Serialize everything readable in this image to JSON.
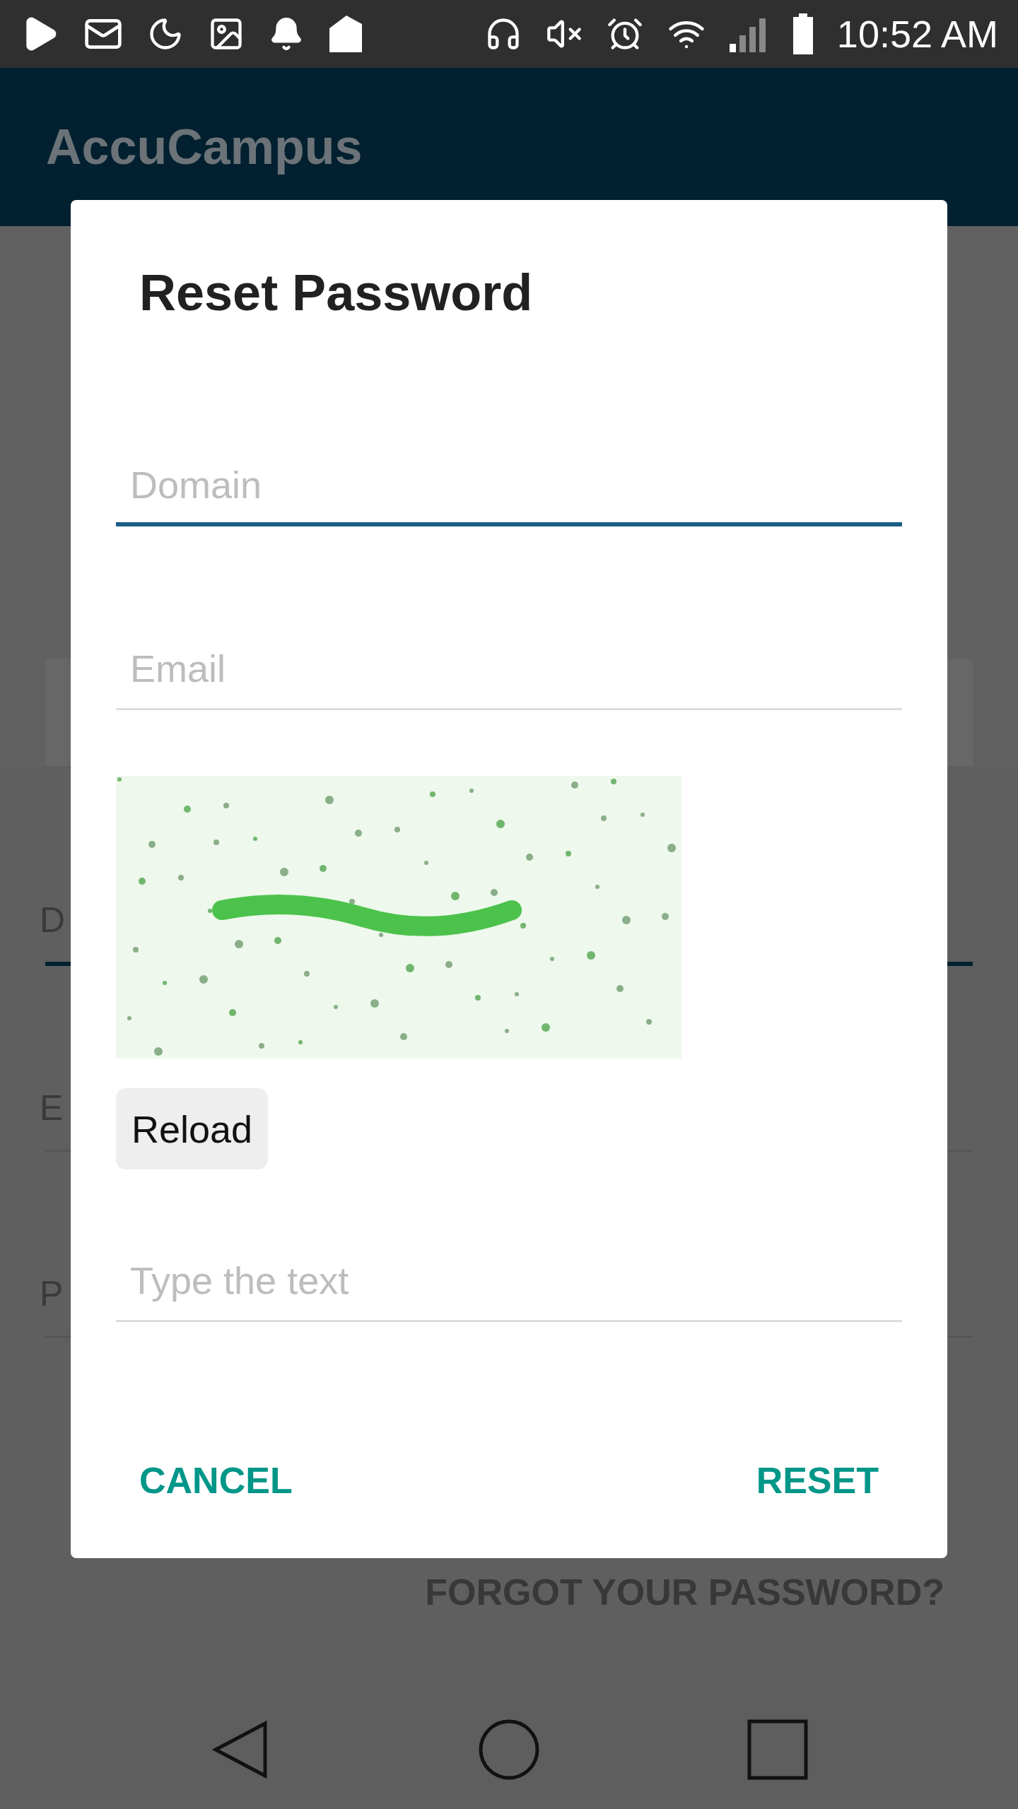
{
  "status_bar": {
    "time": "10:52 AM"
  },
  "app_bar": {
    "title": "AccuCampus"
  },
  "background": {
    "fields": [
      {
        "label": "D",
        "focused": true
      },
      {
        "label": "E",
        "focused": false
      },
      {
        "label": "P",
        "focused": false
      }
    ],
    "link": "FORGOT YOUR PASSWORD?"
  },
  "dialog": {
    "title": "Reset Password",
    "fields": [
      {
        "placeholder": "Domain",
        "focused": true
      },
      {
        "placeholder": "Email",
        "focused": false
      }
    ],
    "captcha": {
      "kind": "picture"
    },
    "reload_button": "Reload",
    "answer_field": {
      "placeholder": "Type the text",
      "focused": false
    },
    "actions": [
      "CANCEL",
      "RESET"
    ]
  }
}
